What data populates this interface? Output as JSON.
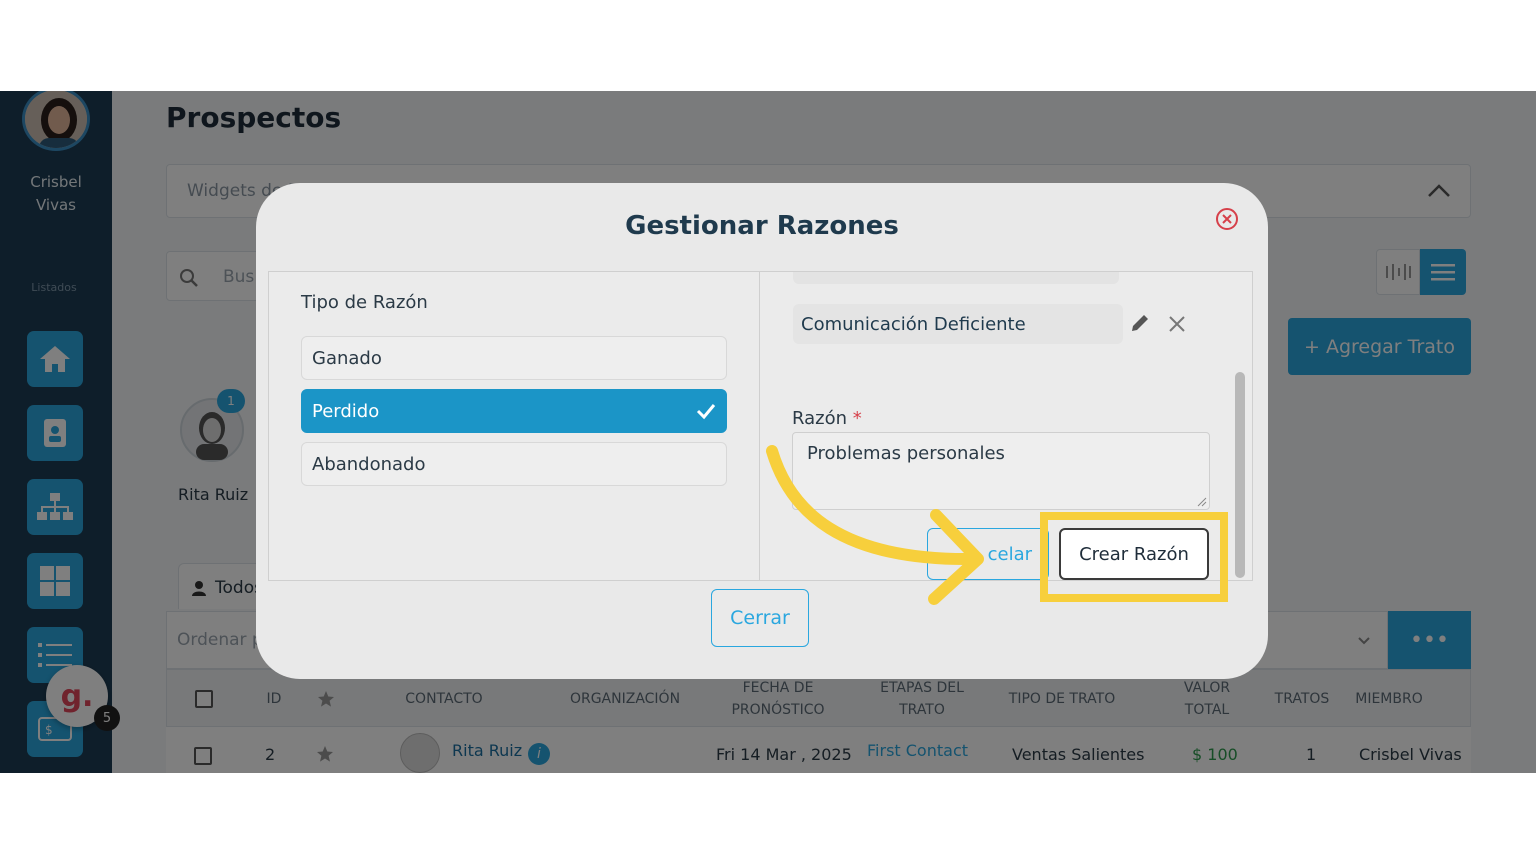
{
  "user": {
    "name": "Crisbel\nVivas"
  },
  "sidebar": {
    "section_label": "Listados",
    "items": [
      {
        "icon": "home-icon"
      },
      {
        "icon": "contacts-icon"
      },
      {
        "icon": "org-chart-icon"
      },
      {
        "icon": "grid-icon"
      },
      {
        "icon": "list-icon"
      },
      {
        "icon": "billing-icon"
      }
    ]
  },
  "grammarly": {
    "letter": "g.",
    "badge": "5"
  },
  "page": {
    "title": "Prospectos",
    "widgets_label": "Widgets de P",
    "search_placeholder": "Bus",
    "add_deal_label": "+ Agregar Trato",
    "member": {
      "count": "1",
      "name": "Rita Ruiz"
    },
    "tab_label": "Todos",
    "sort_label": "Ordenar p",
    "more_label": "•••"
  },
  "table": {
    "headers": [
      "ID",
      "CONTACTO",
      "ORGANIZACIÓN",
      "FECHA DE\nPRONÓSTICO",
      "ETAPAS DEL\nTRATO",
      "TIPO DE TRATO",
      "VALOR\nTOTAL",
      "TRATOS",
      "MIEMBRO"
    ],
    "row": {
      "id": "2",
      "contact": "Rita Ruiz",
      "forecast_date": "Fri 14 Mar , 2025",
      "stage": "First Contact",
      "deal_type": "Ventas Salientes",
      "total": "$ 100",
      "deals": "1",
      "member": "Crisbel Vivas"
    }
  },
  "modal": {
    "title": "Gestionar Razones",
    "type_heading": "Tipo de Razón",
    "types": [
      {
        "label": "Ganado",
        "selected": false
      },
      {
        "label": "Perdido",
        "selected": true
      },
      {
        "label": "Abandonado",
        "selected": false
      }
    ],
    "existing_reason": "Comunicación Deficiente",
    "field_label": "Razón",
    "required_mark": "*",
    "field_value": "Problemas personales",
    "cancel_label": "celar",
    "create_label": "Crear Razón",
    "close_label": "Cerrar"
  },
  "colors": {
    "accent": "#2aa7df",
    "sidebar": "#1d3d55",
    "selected": "#1b95c7",
    "highlight": "#f7cf3c",
    "money": "#2e9b4f"
  }
}
